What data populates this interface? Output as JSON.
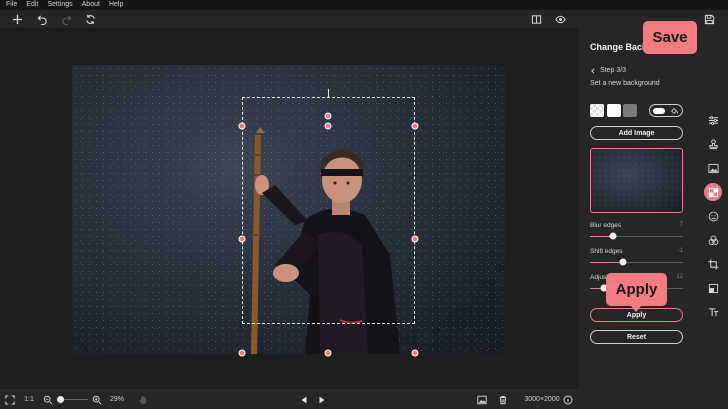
{
  "menu": [
    "File",
    "Edit",
    "Settings",
    "About",
    "Help"
  ],
  "panel": {
    "title": "Change Background",
    "step": "Step 3/3",
    "subtitle": "Set a new background",
    "add_image_label": "Add Image",
    "sliders": [
      {
        "label": "Blur edges",
        "value": "7",
        "fraction": 0.25
      },
      {
        "label": "Shift edges",
        "value": "-1",
        "fraction": 0.35
      },
      {
        "label": "Adjust",
        "value": "12",
        "fraction": 0.15
      }
    ],
    "apply_label": "Apply",
    "reset_label": "Reset"
  },
  "bottombar": {
    "ratio_label": "1:1",
    "zoom_label": "29%",
    "dimensions": "3000×2000"
  },
  "callouts": {
    "save": "Save",
    "apply": "Apply"
  },
  "colors": {
    "accent": "#f07b82",
    "panel_bg": "#262626",
    "canvas_bg": "#1e1e1e"
  },
  "icons": {
    "toolbar": [
      "plus-icon",
      "undo-icon",
      "redo-icon",
      "refresh-icon",
      "compare-icon",
      "eye-icon",
      "save-icon"
    ],
    "tools": [
      "sliders-icon",
      "stamp-icon",
      "image-icon",
      "background-icon",
      "face-icon",
      "circles-icon",
      "crop-icon",
      "frame-icon",
      "text-icon"
    ]
  }
}
